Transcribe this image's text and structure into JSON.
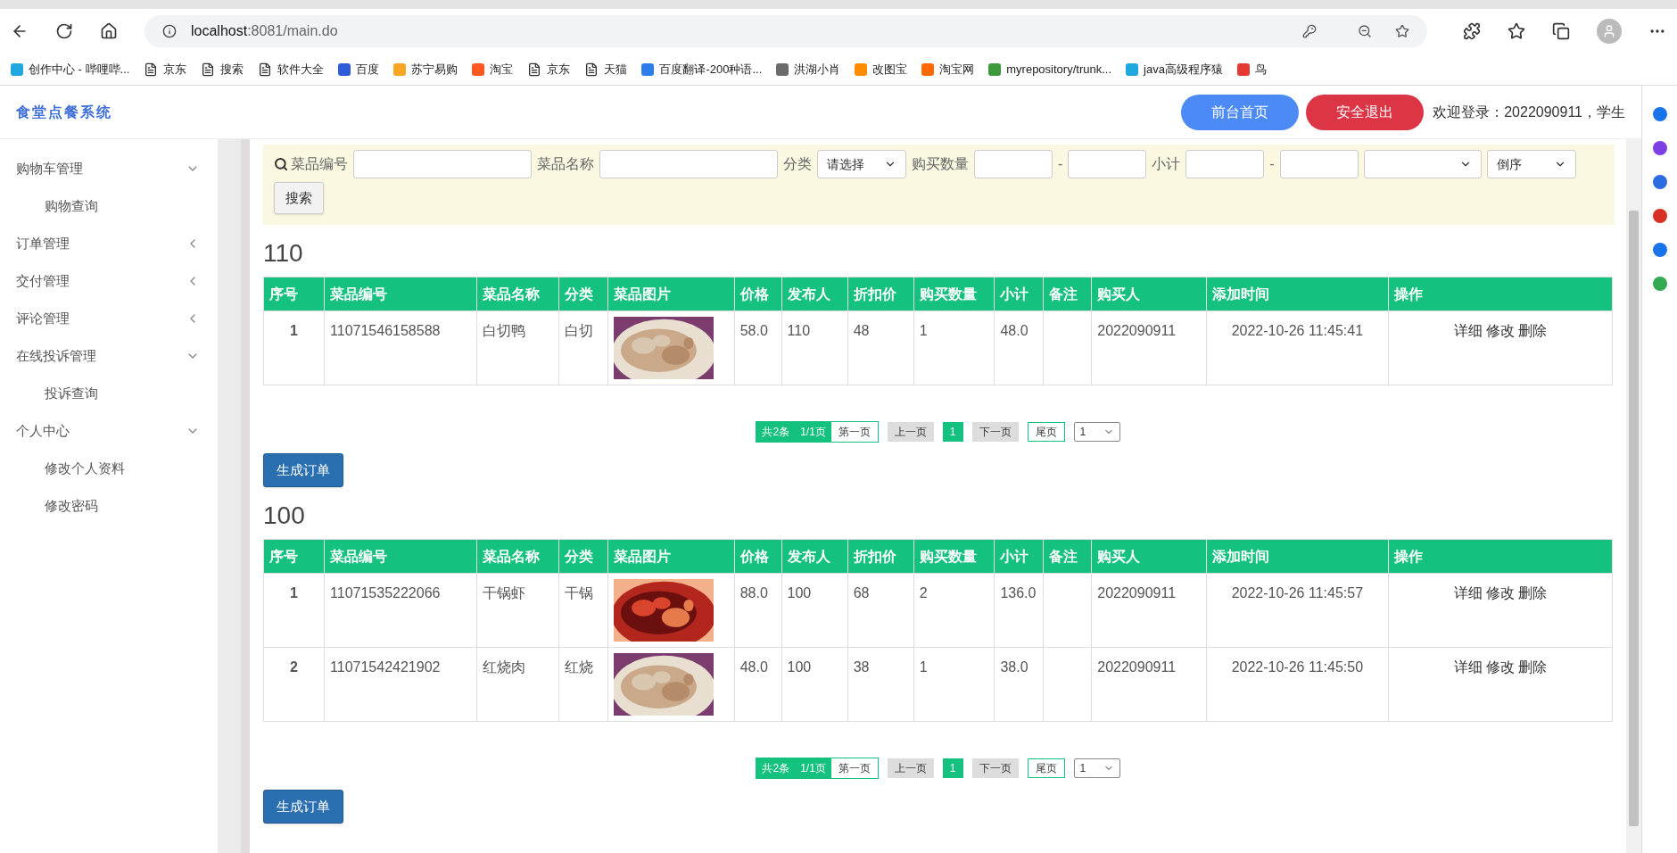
{
  "browser": {
    "url_host": "localhost",
    "url_rest": ":8081/main.do",
    "bookmarks": [
      {
        "kind": "site",
        "color": "#1fa7e0",
        "label": "创作中心 - 哔哩哔..."
      },
      {
        "kind": "page",
        "label": "京东"
      },
      {
        "kind": "page",
        "label": "搜索"
      },
      {
        "kind": "page",
        "label": "软件大全"
      },
      {
        "kind": "site",
        "color": "#2e5bd8",
        "label": "百度"
      },
      {
        "kind": "site",
        "color": "#f5a623",
        "label": "苏宁易购"
      },
      {
        "kind": "site",
        "color": "#ff5722",
        "label": "淘宝"
      },
      {
        "kind": "page",
        "label": "京东"
      },
      {
        "kind": "page",
        "label": "天猫"
      },
      {
        "kind": "site",
        "color": "#2b7de9",
        "label": "百度翻译-200种语..."
      },
      {
        "kind": "site",
        "color": "#6b6b6b",
        "label": "洪湖小肖"
      },
      {
        "kind": "site",
        "color": "#ff8c00",
        "label": "改图宝"
      },
      {
        "kind": "site",
        "color": "#ff6a00",
        "label": "淘宝网"
      },
      {
        "kind": "site",
        "color": "#3c9a3c",
        "label": "myrepository/trunk..."
      },
      {
        "kind": "site",
        "color": "#1fa7e0",
        "label": "java高级程序猿"
      },
      {
        "kind": "site",
        "color": "#e53935",
        "label": "鸟"
      }
    ]
  },
  "header": {
    "title": "食堂点餐系统",
    "buttons": [
      {
        "label": "前台首页",
        "kind": "primary"
      },
      {
        "label": "安全退出",
        "kind": "danger"
      }
    ],
    "welcome": "欢迎登录：2022090911，学生"
  },
  "sidebar": {
    "items": [
      {
        "label": "购物车管理",
        "expanded": true,
        "children": [
          {
            "label": "购物查询"
          }
        ]
      },
      {
        "label": "订单管理",
        "expanded": false
      },
      {
        "label": "交付管理",
        "expanded": false
      },
      {
        "label": "评论管理",
        "expanded": false
      },
      {
        "label": "在线投诉管理",
        "expanded": true,
        "children": [
          {
            "label": "投诉查询"
          }
        ]
      },
      {
        "label": "个人中心",
        "expanded": true,
        "children": [
          {
            "label": "修改个人资料"
          },
          {
            "label": "修改密码"
          }
        ]
      }
    ]
  },
  "search": {
    "items": [
      {
        "kind": "label",
        "text": "菜品编号"
      },
      {
        "kind": "input"
      },
      {
        "kind": "label",
        "text": "菜品名称"
      },
      {
        "kind": "input"
      },
      {
        "kind": "label",
        "text": "分类"
      },
      {
        "kind": "select",
        "value": "请选择"
      },
      {
        "kind": "label",
        "text": "购买数量"
      },
      {
        "kind": "input"
      },
      {
        "kind": "dash",
        "text": "-"
      },
      {
        "kind": "input"
      },
      {
        "kind": "label",
        "text": "小计"
      },
      {
        "kind": "input"
      },
      {
        "kind": "dash",
        "text": "-"
      },
      {
        "kind": "input"
      },
      {
        "kind": "select"
      },
      {
        "kind": "select",
        "value": "倒序"
      }
    ],
    "button": "搜索"
  },
  "sections": [
    {
      "title": "110",
      "columns": [
        "序号",
        "菜品编号",
        "菜品名称",
        "分类",
        "菜品图片",
        "价格",
        "发布人",
        "折扣价",
        "购买数量",
        "小计",
        "备注",
        "购买人",
        "添加时间",
        "操作"
      ],
      "rows": [
        {
          "no": "1",
          "code": "11071546158588",
          "name": "白切鸭",
          "category": "白切",
          "price": "58.0",
          "publisher": "110",
          "discount": "48",
          "qty": "1",
          "subtotal": "48.0",
          "buyer": "2022090911",
          "time": "2022-10-26 11:45:41",
          "actions": [
            "详细",
            "修改",
            "删除"
          ]
        }
      ],
      "pagination": {
        "total": "共2条",
        "pages": "1/1页",
        "first": "第一页",
        "prev": "上一页",
        "page": {
          "label": "1",
          "selected": true
        },
        "next": "下一页",
        "last": "尾页",
        "select": "1"
      },
      "button": "生成订单"
    },
    {
      "title": "100",
      "columns": [
        "序号",
        "菜品编号",
        "菜品名称",
        "分类",
        "菜品图片",
        "价格",
        "发布人",
        "折扣价",
        "购买数量",
        "小计",
        "备注",
        "购买人",
        "添加时间",
        "操作"
      ],
      "rows": [
        {
          "no": "1",
          "code": "11071535222066",
          "name": "干锅虾",
          "category": "干锅",
          "price": "88.0",
          "publisher": "100",
          "discount": "68",
          "qty": "2",
          "subtotal": "136.0",
          "buyer": "2022090911",
          "time": "2022-10-26 11:45:57",
          "actions": [
            "详细",
            "修改",
            "删除"
          ]
        },
        {
          "no": "2",
          "code": "11071542421902",
          "name": "红烧肉",
          "category": "红烧",
          "price": "48.0",
          "publisher": "100",
          "discount": "38",
          "qty": "1",
          "subtotal": "38.0",
          "buyer": "2022090911",
          "time": "2022-10-26 11:45:50",
          "actions": [
            "详细",
            "修改",
            "删除"
          ]
        }
      ],
      "pagination": {
        "total": "共2条",
        "pages": "1/1页",
        "first": "第一页",
        "prev": "上一页",
        "page": {
          "label": "1",
          "selected": true
        },
        "next": "下一页",
        "last": "尾页",
        "select": "1"
      },
      "button": "生成订单"
    }
  ]
}
